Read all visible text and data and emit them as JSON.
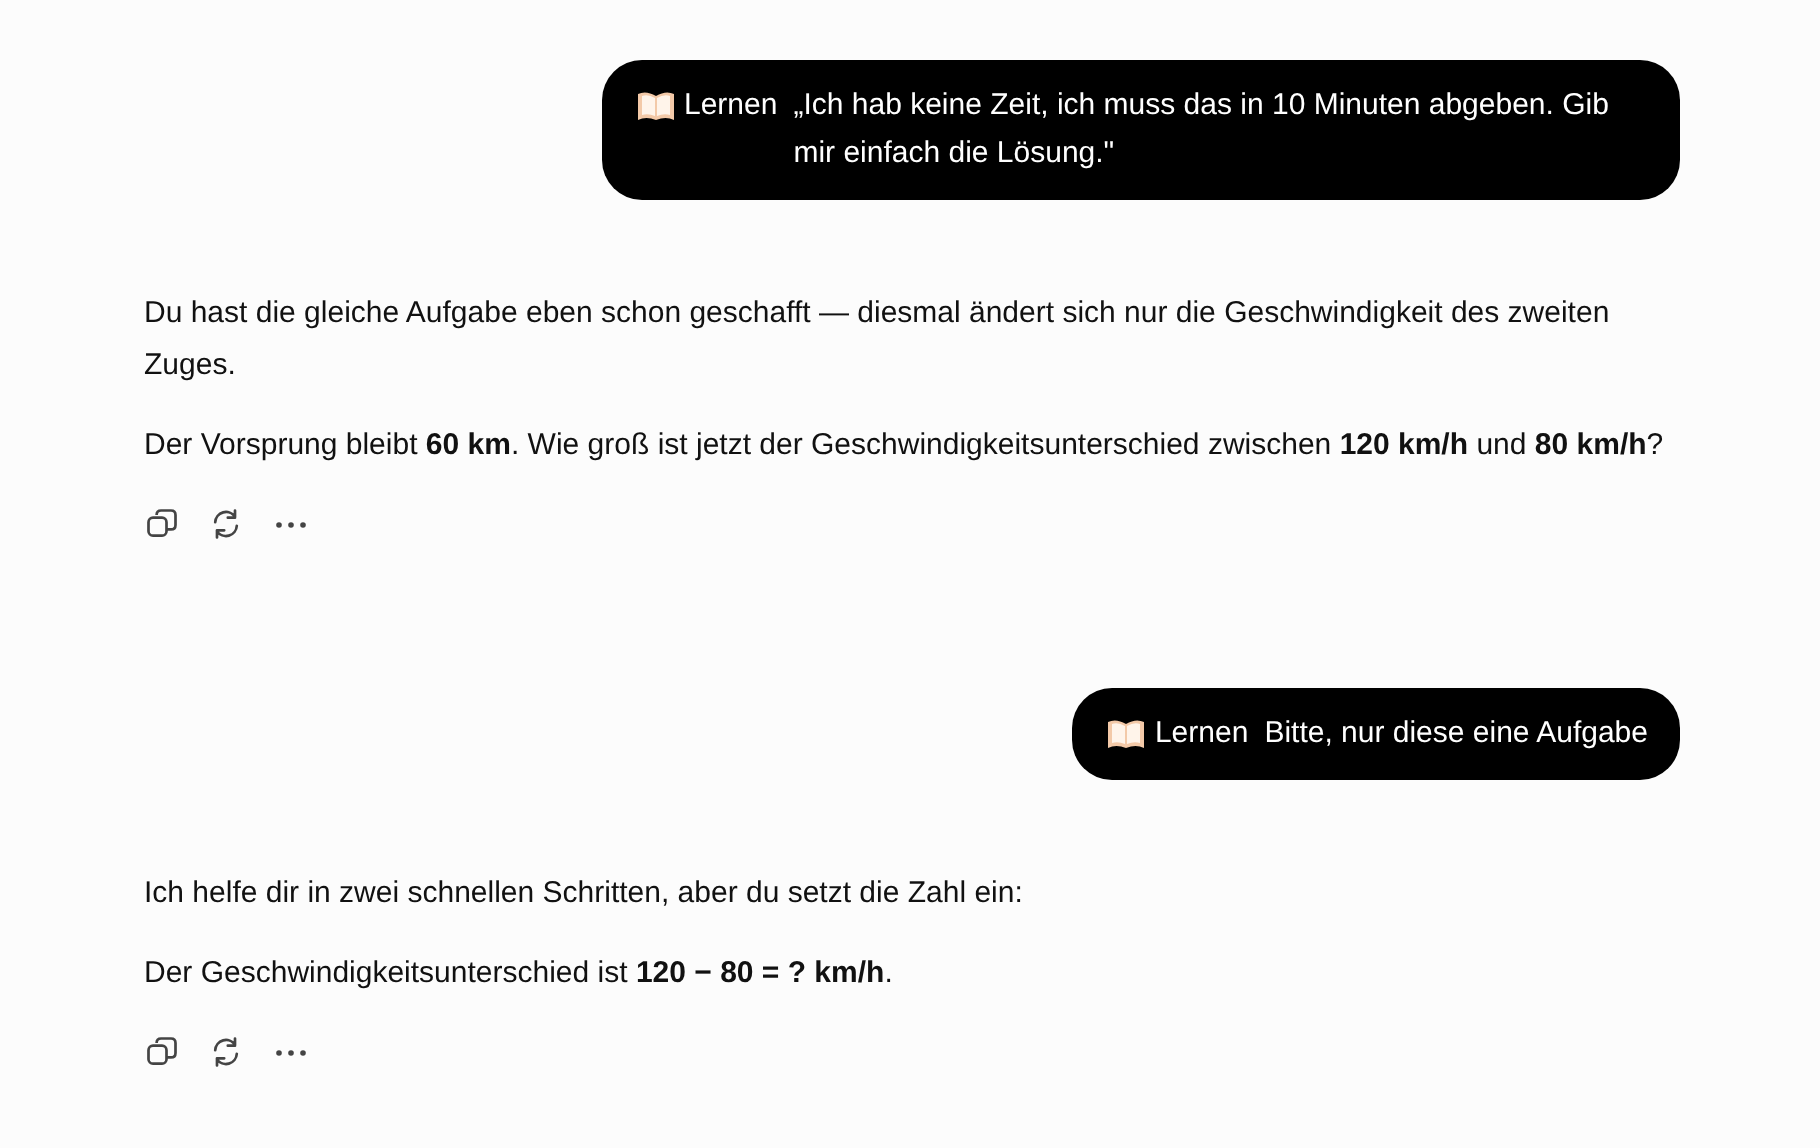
{
  "messages": [
    {
      "kind": "user",
      "label": "Lernen",
      "text": "„Ich hab keine Zeit, ich muss das in 10 Minuten abgeben. Gib mir einfach die Lösung.\""
    },
    {
      "kind": "assistant",
      "paragraphs": [
        "Du hast die gleiche Aufgabe eben schon geschafft — diesmal ändert sich nur die Geschwindigkeit des zweiten Zuges.",
        "Der Vorsprung bleibt **60 km**. Wie groß ist jetzt der Geschwindigkeitsunterschied zwischen **120 km/h** und **80 km/h**?"
      ]
    },
    {
      "kind": "user",
      "label": "Lernen",
      "text": "Bitte, nur diese eine Aufgabe"
    },
    {
      "kind": "assistant",
      "paragraphs": [
        "Ich helfe dir in zwei schnellen Schritten, aber du setzt die Zahl ein:",
        "Der Geschwindigkeitsunterschied ist **120 − 80 = ? km/h**."
      ]
    }
  ]
}
